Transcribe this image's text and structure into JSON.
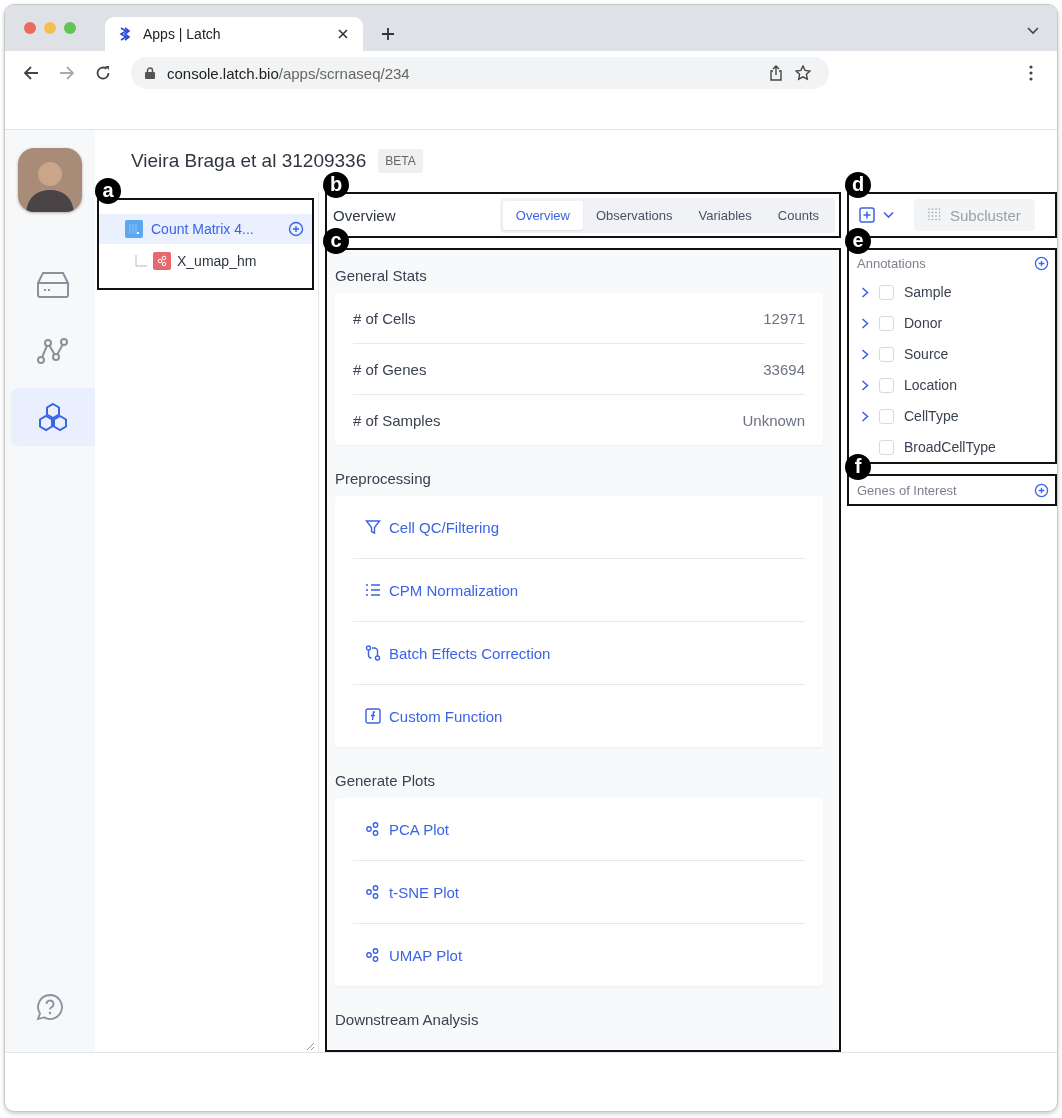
{
  "browser": {
    "tab_title": "Apps | Latch",
    "url_host": "console.latch.bio",
    "url_path": "/apps/scrnaseq/234"
  },
  "rail": {
    "items": [
      {
        "kind": "storage",
        "selected": false
      },
      {
        "kind": "graph",
        "selected": false
      },
      {
        "kind": "cells",
        "selected": true
      }
    ]
  },
  "page": {
    "title": "Vieira Braga et al 31209336",
    "badge": "BETA"
  },
  "tree": {
    "marker": "a",
    "items": [
      {
        "label": "Count Matrix 4...",
        "selected": true,
        "children": [
          {
            "label": "X_umap_hm",
            "selected": false
          }
        ]
      }
    ]
  },
  "view": {
    "marker": "b",
    "heading": "Overview",
    "tabs": [
      {
        "label": "Overview",
        "selected": true
      },
      {
        "label": "Observations",
        "selected": false
      },
      {
        "label": "Variables",
        "selected": false
      },
      {
        "label": "Counts",
        "selected": false
      }
    ]
  },
  "content": {
    "marker": "c",
    "sections": [
      {
        "title": "General Stats",
        "kind": "stats",
        "rows": [
          {
            "label": "# of Cells",
            "value": "12971"
          },
          {
            "label": "# of Genes",
            "value": "33694"
          },
          {
            "label": "# of Samples",
            "value": "Unknown"
          }
        ]
      },
      {
        "title": "Preprocessing",
        "kind": "actions",
        "items": [
          {
            "label": "Cell QC/Filtering",
            "kind": "filter"
          },
          {
            "label": "CPM Normalization",
            "kind": "list"
          },
          {
            "label": "Batch Effects Correction",
            "kind": "branch"
          },
          {
            "label": "Custom Function",
            "kind": "function"
          }
        ]
      },
      {
        "title": "Generate Plots",
        "kind": "actions",
        "items": [
          {
            "label": "PCA Plot",
            "kind": "scatter"
          },
          {
            "label": "t-SNE Plot",
            "kind": "scatter"
          },
          {
            "label": "UMAP Plot",
            "kind": "scatter"
          }
        ]
      },
      {
        "title": "Downstream Analysis",
        "kind": "heading"
      }
    ]
  },
  "toolbar": {
    "marker": "d",
    "subcluster": "Subcluster",
    "subcluster_disabled": true
  },
  "annotations": {
    "marker": "e",
    "title": "Annotations",
    "items": [
      {
        "label": "Sample",
        "expandable": true,
        "checked": false
      },
      {
        "label": "Donor",
        "expandable": true,
        "checked": false
      },
      {
        "label": "Source",
        "expandable": true,
        "checked": false
      },
      {
        "label": "Location",
        "expandable": true,
        "checked": false
      },
      {
        "label": "CellType",
        "expandable": true,
        "checked": false
      },
      {
        "label": "BroadCellType",
        "expandable": false,
        "checked": false
      }
    ]
  },
  "genes": {
    "marker": "f",
    "title": "Genes of Interest"
  }
}
